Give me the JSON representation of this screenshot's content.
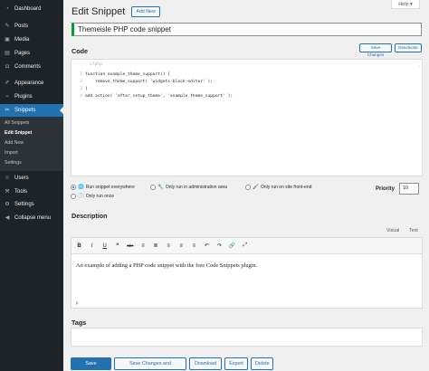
{
  "sidebar": {
    "dashboard": "Dashboard",
    "posts": "Posts",
    "media": "Media",
    "pages": "Pages",
    "comments": "Comments",
    "appearance": "Appearance",
    "plugins": "Plugins",
    "snippets": "Snippets",
    "sub": [
      "All Snippets",
      "Edit Snippet",
      "Add New",
      "Import",
      "Settings"
    ],
    "users": "Users",
    "tools": "Tools",
    "settings": "Settings",
    "collapse": "Collapse menu"
  },
  "header": {
    "help": "Help ▾",
    "title": "Edit Snippet",
    "add_new": "Add New"
  },
  "snippet_title": "Themeisle PHP code snippet",
  "code_section": {
    "label": "Code",
    "save_changes": "Save Changes",
    "deactivate": "Deactivate",
    "open_tag": "<?php",
    "lines": [
      {
        "n": "1",
        "text": "function example_theme_support() {"
      },
      {
        "n": "2",
        "text": "    remove_theme_support( 'widgets-block-editor' );"
      },
      {
        "n": "3",
        "text": "}"
      },
      {
        "n": "4",
        "text": "add_action( 'after_setup_theme', 'example_theme_support' );"
      }
    ]
  },
  "scope": {
    "everywhere": "Run snippet everywhere",
    "admin": "Only run in administration area",
    "frontend": "Only run on site front-end",
    "once": "Only run once",
    "priority_label": "Priority",
    "priority_value": "10"
  },
  "description": {
    "label": "Description",
    "tab_visual": "Visual",
    "tab_text": "Text",
    "content": "An example of adding a PHP code snippet with the free Code Snippets plugin.",
    "path": "p"
  },
  "toolbar_icons": [
    "B",
    "I",
    "U",
    "❝",
    "abc",
    "≡",
    "≣",
    "≡",
    "≡",
    "≡",
    "↶",
    "↷",
    "🔗",
    "⤢"
  ],
  "tags": {
    "label": "Tags"
  },
  "footer": {
    "save": "Save Changes",
    "save_deactivate": "Save Changes and Deactivate",
    "download": "Download",
    "export": "Export",
    "delete": "Delete"
  },
  "colors": {
    "accent": "#2271b1",
    "sidebar_bg": "#1d2327",
    "active_border": "#00a32a"
  }
}
